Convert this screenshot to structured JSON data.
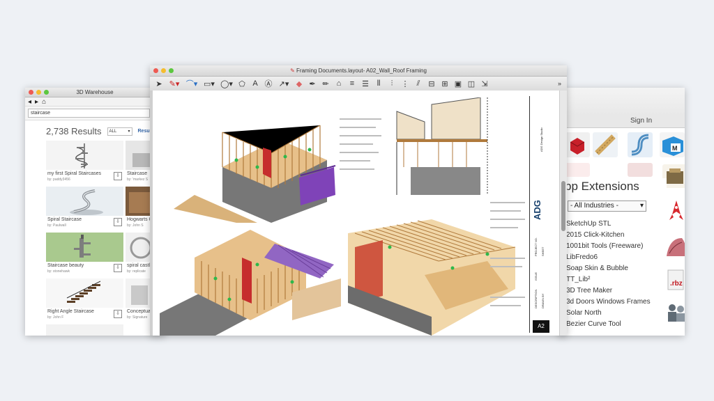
{
  "warehouse": {
    "title": "3D Warehouse",
    "search_value": "staircase",
    "results_count": "2,738 Results",
    "filter_value": "ALL",
    "results_label": "Resul",
    "cards": [
      {
        "title": "my first Spiral Staircases",
        "by": "by: paddy3456"
      },
      {
        "title": "Staircase",
        "by": "by: 'markez S"
      },
      {
        "title": "Spiral Staircase",
        "by": "by: Paulwall"
      },
      {
        "title": "Hogwarts G",
        "by": "by: John S"
      },
      {
        "title": "Staircase beauty",
        "by": "by: stonehawk"
      },
      {
        "title": "spiral castle",
        "by": "by: replicate"
      },
      {
        "title": "Right Angle Staircase",
        "by": "by: John F"
      },
      {
        "title": "Conceptua",
        "by": "by: Signature"
      }
    ]
  },
  "layout": {
    "title": "Framing Documents.layout- A02_Wall_Roof Framing",
    "more": "»",
    "titleblock": {
      "firm": "ADG",
      "sheet": "A2",
      "labels": [
        "ADG Design Studio",
        "PROJECT NO.",
        "ISSUE",
        "SHEET",
        "DESCRIPTION",
        "DRAWN BY"
      ]
    }
  },
  "extensions": {
    "signin": "Sign In",
    "panel_title": "pp Extensions",
    "filter": "- All Industries -",
    "items": [
      "SketchUp STL",
      "2015 Click-Kitchen",
      "1001bit Tools (Freeware)",
      "LibFredo6",
      "Soap Skin & Bubble",
      "TT_Lib²",
      "3D Tree Maker",
      "3d Doors Windows Frames",
      "Solar North",
      "Bezier Curve Tool"
    ]
  }
}
